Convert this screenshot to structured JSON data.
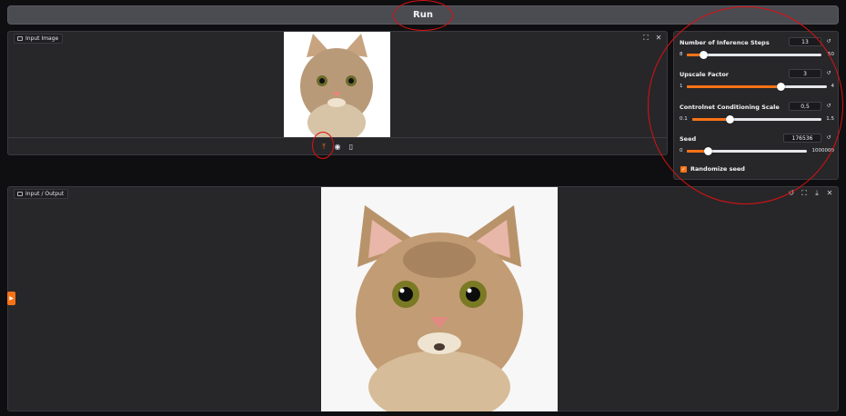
{
  "run_button": {
    "label": "Run"
  },
  "input_image": {
    "label": "Input Image",
    "top_icons": [
      "fullscreen-icon",
      "close-icon"
    ],
    "toolbar": [
      "upload-icon",
      "webcam-icon",
      "clipboard-icon"
    ]
  },
  "settings": {
    "steps": {
      "label": "Number of Inference Steps",
      "value": 13,
      "min": 8,
      "max": 50,
      "min_label": "8",
      "max_label": "50",
      "value_label": "13"
    },
    "upscale": {
      "label": "Upscale Factor",
      "value": 3,
      "min": 1,
      "max": 4,
      "min_label": "1",
      "max_label": "4",
      "value_label": "3"
    },
    "controlnet": {
      "label": "Controlnet Conditioning Scale",
      "value": 0.5,
      "min": 0.1,
      "max": 1.5,
      "min_label": "0.1",
      "max_label": "1.5",
      "value_label": "0,5"
    },
    "seed": {
      "label": "Seed",
      "value": 176536,
      "min": 0,
      "max": 1000000,
      "min_label": "0",
      "max_label": "1000000",
      "value_label": "176536"
    },
    "randomize": {
      "label": "Randomize seed",
      "checked": true
    }
  },
  "output": {
    "label": "Input / Output",
    "top_icons": [
      "undo-icon",
      "fullscreen-icon",
      "download-icon",
      "close-icon"
    ]
  },
  "colors": {
    "accent": "#f97316",
    "annotation": "#dd1111",
    "panel": "#27272a",
    "background": "#0f0f11"
  }
}
